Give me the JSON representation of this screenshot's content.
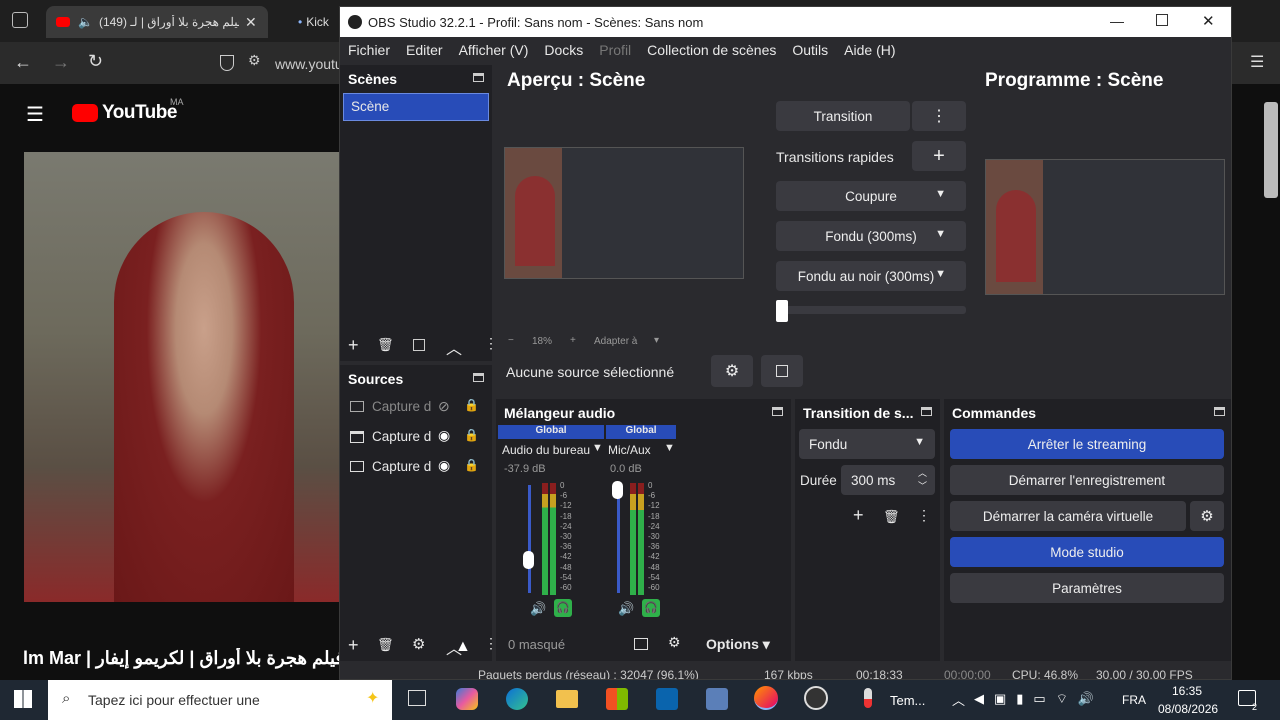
{
  "browser": {
    "tab_active_label": "(149) فيلم هجرة بلا أوراق | لـ",
    "tab_inactive_label": "Kick",
    "url": "www.youtu",
    "youtube_logo_text": "YouTube",
    "youtube_region": "MA",
    "video_title": "فيلم هجرة بلا أوراق | لكريمو إيفار | Film Mar"
  },
  "obs": {
    "window_title": "OBS Studio 32.2.1 - Profil: Sans nom - Scènes: Sans nom",
    "menu": [
      "Fichier",
      "Editer",
      "Afficher (V)",
      "Docks",
      "Profil",
      "Collection de scènes",
      "Outils",
      "Aide (H)"
    ],
    "scenes": {
      "title": "Scènes",
      "items": [
        "Scène"
      ]
    },
    "sources": {
      "title": "Sources",
      "items": [
        "Capture d",
        "Capture d",
        "Capture d"
      ]
    },
    "preview": {
      "title": "Aperçu : Scène",
      "zoom": "18%",
      "fit_label": "Adapter à"
    },
    "program": {
      "title": "Programme : Scène"
    },
    "transitions": {
      "transition_button": "Transition",
      "quick_label": "Transitions rapides",
      "quick_items": [
        "Coupure",
        "Fondu (300ms)",
        "Fondu au noir (300ms)"
      ]
    },
    "no_source_label": "Aucune source sélectionné",
    "audio_mixer": {
      "title": "Mélangeur audio",
      "channels": [
        {
          "badge": "Global",
          "name": "Audio du bureau",
          "db": "-37.9 dB"
        },
        {
          "badge": "Global",
          "name": "Mic/Aux",
          "db": "0.0 dB"
        }
      ],
      "scale": [
        "0",
        "-6",
        "-12",
        "-18",
        "-24",
        "-30",
        "-36",
        "-42",
        "-48",
        "-54",
        "-60"
      ],
      "hidden_label": "0 masqué",
      "options_label": "Options"
    },
    "scene_transition": {
      "title": "Transition de s...",
      "selected": "Fondu",
      "duration_label": "Durée",
      "duration_value": "300 ms"
    },
    "controls": {
      "title": "Commandes",
      "buttons": [
        "Arrêter le streaming",
        "Démarrer l'enregistrement",
        "Démarrer la caméra virtuelle",
        "Mode studio",
        "Paramètres"
      ]
    },
    "status": {
      "dropped": "Paquets perdus (réseau) : 32047 (96.1%)",
      "bitrate": "167 kbps",
      "stream_time": "00:18:33",
      "rec_time": "00:00:00",
      "cpu": "CPU: 46.8%",
      "fps": "30.00 / 30.00 FPS"
    }
  },
  "taskbar": {
    "search_placeholder": "Tapez ici pour effectuer une",
    "weather_label": "Tem...",
    "lang": "FRA",
    "time": "16:35",
    "date": "08/08/2026",
    "notif_count": "2"
  },
  "colors": {
    "obs_blue": "#284cb8",
    "meter_green": "#2fb04a",
    "meter_yellow": "#c8a020",
    "meter_red": "#8a1e1e",
    "youtube_red": "#ff0000"
  }
}
